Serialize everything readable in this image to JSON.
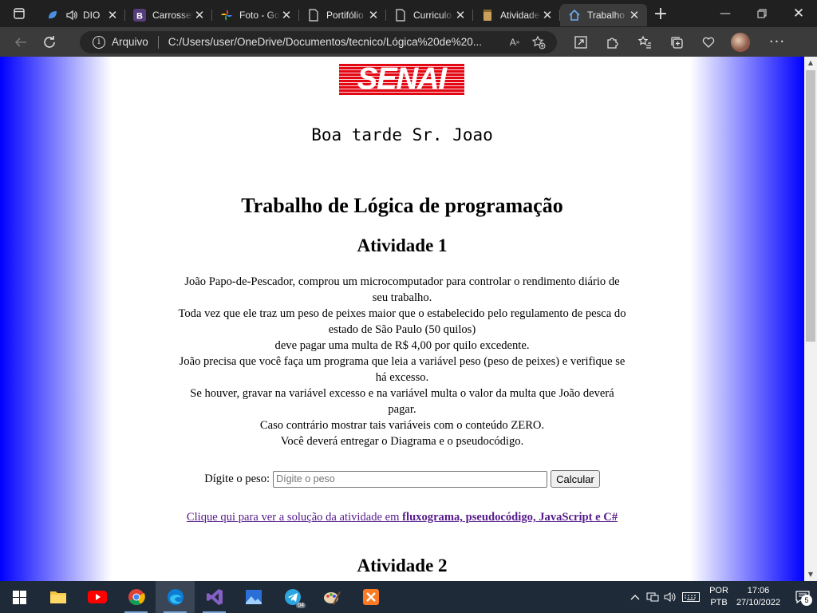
{
  "browser": {
    "tabs": [
      {
        "title": "DIO",
        "icon": "dio-logo-icon",
        "audio": true
      },
      {
        "title": "Carrossel",
        "icon": "bootstrap-icon"
      },
      {
        "title": "Foto - Google",
        "icon": "google-photos-icon"
      },
      {
        "title": "Portifólio",
        "icon": "page-icon"
      },
      {
        "title": "Curriculo",
        "icon": "page-icon"
      },
      {
        "title": "Atividade",
        "icon": "parchment-icon"
      },
      {
        "title": "Trabalho",
        "icon": "home-icon",
        "active": true
      }
    ],
    "address": {
      "security_label": "Arquivo",
      "url": "C:/Users/user/OneDrive/Documentos/tecnico/Lógica%20de%20..."
    }
  },
  "page": {
    "logo_text": "SENAI",
    "greeting": "Boa tarde Sr. Joao",
    "title": "Trabalho de Lógica de programação",
    "activity1": {
      "heading": "Atividade 1",
      "lines": [
        "João Papo-de-Pescador, comprou um microcomputador para controlar o rendimento diário de seu trabalho.",
        "Toda vez que ele traz um peso de peixes maior que o estabelecido pelo regulamento de pesca do estado de São Paulo (50 quilos)",
        "deve pagar uma multa de R$ 4,00 por quilo excedente.",
        "João precisa que você faça um programa que leia a variável peso (peso de peixes) e verifique se há excesso.",
        "Se houver, gravar na variável excesso e na variável multa o valor da multa que João deverá pagar.",
        "Caso contrário mostrar tais variáveis com o conteúdo ZERO.",
        "Você deverá entregar o Diagrama e o pseudocódigo."
      ],
      "input_label": "Dígite o peso:",
      "input_placeholder": "Dígite o peso",
      "input_value": "",
      "button_label": "Calcular",
      "link_prefix": "Clique qui para ver a solução da atividade em ",
      "link_bold": "fluxograma, pseudocódigo, JavaScript e C#"
    },
    "activity2": {
      "heading": "Atividade 2"
    }
  },
  "taskbar": {
    "apps": [
      "file-explorer-icon",
      "youtube-icon",
      "chrome-icon",
      "edge-icon",
      "visual-studio-icon",
      "photos-icon",
      "telegram-icon",
      "paint-icon",
      "xampp-icon"
    ],
    "telegram_badge": "04",
    "language_line1": "POR",
    "language_line2": "PTB",
    "time": "17:06",
    "date": "27/10/2022",
    "notification_count": "5"
  },
  "colors": {
    "page_gradient_edge": "#0000ff",
    "senai_red": "#e30613",
    "link_visited": "#551a8b",
    "browser_dark": "#202020",
    "toolbar": "#3b3b3b",
    "taskbar": "#1e2a38"
  }
}
